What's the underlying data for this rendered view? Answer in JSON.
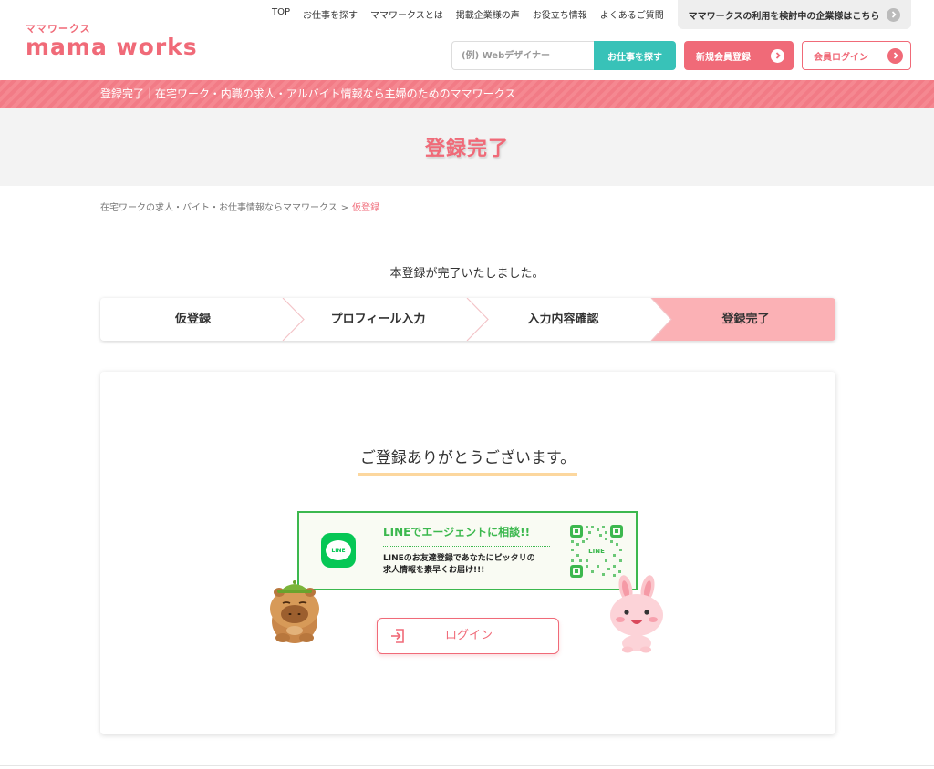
{
  "header": {
    "logo_kana": "ママワークス",
    "logo_main": "mama works",
    "nav": [
      "TOP",
      "お仕事を探す",
      "ママワークスとは",
      "掲載企業様の声",
      "お役立ち情報",
      "よくあるご質問"
    ],
    "corp_link": "ママワークスの利用を検討中の企業様はこちら",
    "search_placeholder": "(例) Webデザイナー",
    "search_button": "お仕事を探す",
    "register_button": "新規会員登録",
    "login_button": "会員ログイン"
  },
  "banner": {
    "text": "登録完了｜在宅ワーク・内職の求人・アルバイト情報なら主婦のためのママワークス"
  },
  "page": {
    "title": "登録完了"
  },
  "breadcrumb": {
    "home": "在宅ワークの求人・バイト・お仕事情報ならママワークス",
    "separator": ">",
    "current": "仮登録"
  },
  "message": {
    "complete": "本登録が完了いたしました。"
  },
  "steps": {
    "items": [
      "仮登録",
      "プロフィール入力",
      "入力内容確認",
      "登録完了"
    ],
    "active_index": 3
  },
  "card": {
    "thanks": "ご登録ありがとうございます。",
    "line_banner": {
      "logo_text": "LINE",
      "headline": "LINEでエージェントに相談!!",
      "desc_line1": "LINEのお友達登録であなたにピッタリの",
      "desc_line2": "求人情報を素早くお届け!!!",
      "qr_label": "LINE"
    },
    "login_button": "ログイン"
  },
  "colors": {
    "brand_pink": "#f06a78",
    "teal": "#38c2b8",
    "line_green": "#3cb84e",
    "step_active": "#fbb1b5",
    "underline_yellow": "#fcd79e"
  }
}
